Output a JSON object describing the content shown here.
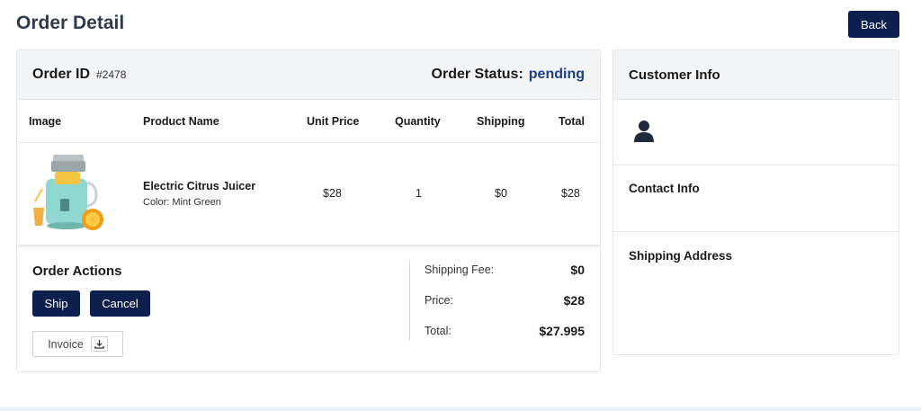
{
  "page": {
    "title": "Order Detail",
    "back_label": "Back"
  },
  "order": {
    "id_label": "Order ID",
    "id_value": "#2478",
    "status_label": "Order Status:",
    "status_value": "pending",
    "status_color": "#1c3f85"
  },
  "table": {
    "headers": [
      "Image",
      "Product Name",
      "Unit Price",
      "Quantity",
      "Shipping",
      "Total"
    ],
    "rows": [
      {
        "image_icon": "juicer-product-image",
        "product_name": "Electric Citrus Juicer",
        "variant": "Color: Mint Green",
        "unit_price": "$28",
        "quantity": "1",
        "shipping": "$0",
        "total": "$28"
      }
    ]
  },
  "actions": {
    "title": "Order Actions",
    "ship_label": "Ship",
    "cancel_label": "Cancel",
    "invoice_label": "Invoice",
    "invoice_icon": "download-icon"
  },
  "summary": {
    "shipping_fee_label": "Shipping Fee:",
    "shipping_fee_value": "$0",
    "price_label": "Price:",
    "price_value": "$28",
    "total_label": "Total:",
    "total_value": "$27.995"
  },
  "customer": {
    "title": "Customer Info",
    "avatar_icon": "user-icon",
    "contact_title": "Contact Info",
    "shipping_title": "Shipping Address"
  },
  "colors": {
    "primary": "#0d1f4e",
    "header_bg": "#f3f4f6",
    "border": "#e3e6ea"
  }
}
